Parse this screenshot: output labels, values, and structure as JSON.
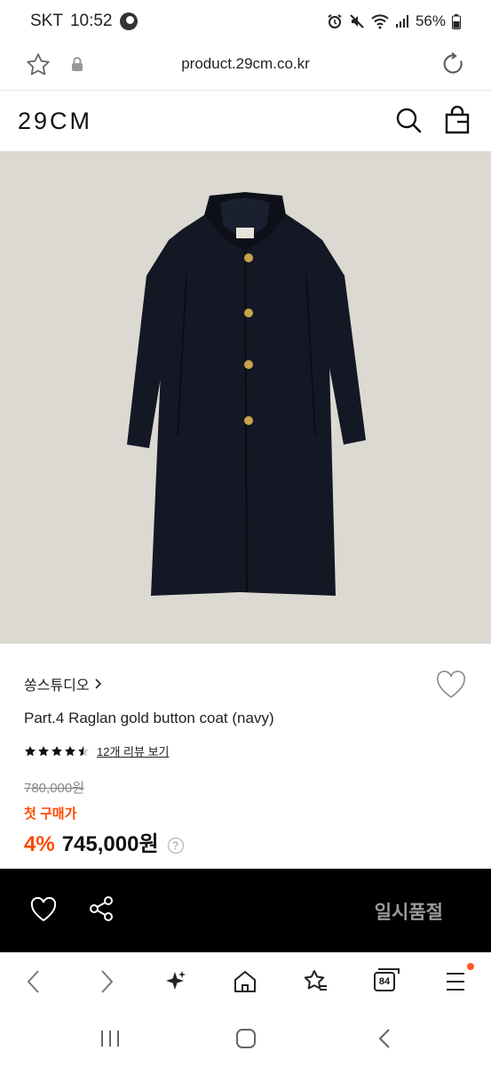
{
  "status_bar": {
    "carrier": "SKT",
    "time": "10:52",
    "battery": "56%"
  },
  "browser": {
    "url": "product.29cm.co.kr"
  },
  "site": {
    "logo": "29CM"
  },
  "product": {
    "brand": "쏭스튜디오",
    "name": "Part.4 Raglan gold button coat (navy)",
    "rating_stars": 4.5,
    "review_link": "12개 리뷰 보기",
    "original_price": "780,000원",
    "first_purchase_label": "첫 구매가",
    "discount": "4%",
    "sale_price": "745,000원",
    "help_symbol": "?"
  },
  "action_bar": {
    "soldout_label": "일시품절"
  },
  "browser_nav": {
    "tab_count": "84"
  },
  "colors": {
    "accent": "#ff4800",
    "image_bg": "#dcd9d3",
    "coat": "#141824",
    "action_bar_bg": "#000000"
  }
}
